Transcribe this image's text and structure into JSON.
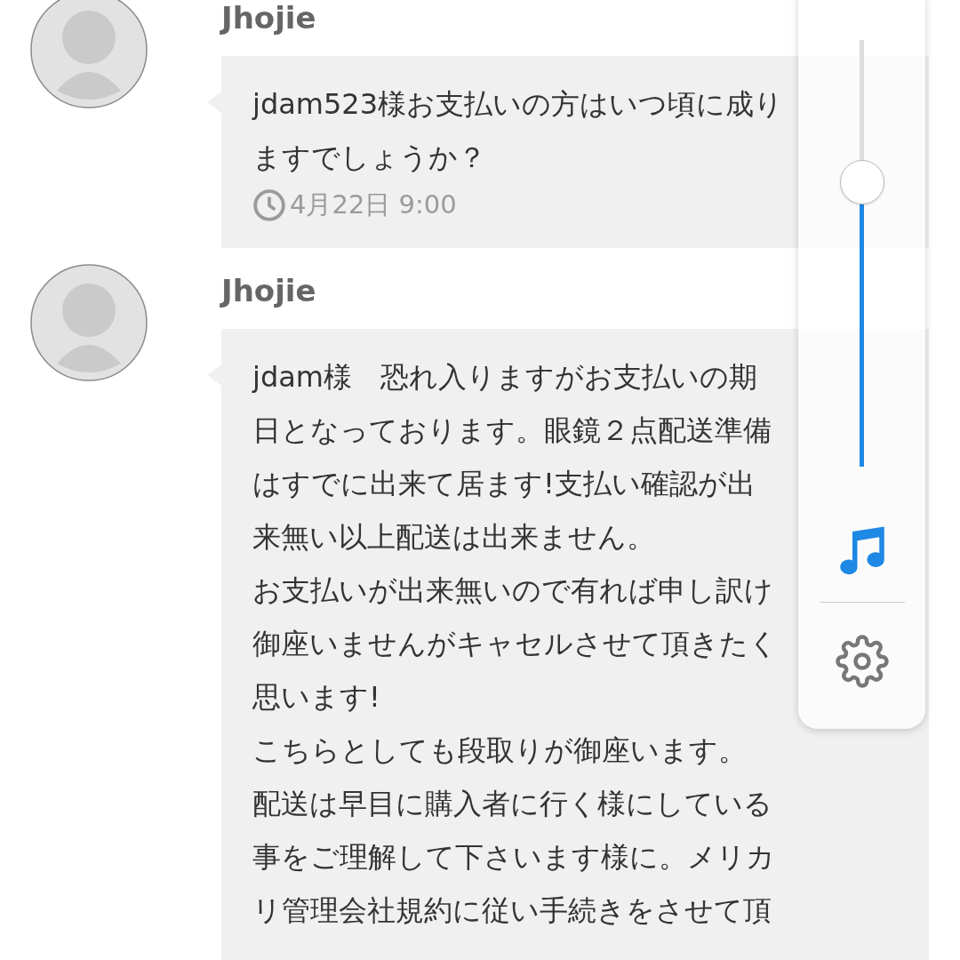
{
  "messages": [
    {
      "sender": "Jhojie",
      "lines": [
        "jdam523様お支払いの方はいつ頃に成り",
        "ますでしょうか？"
      ],
      "time": "4月22日 9:00"
    },
    {
      "sender": "Jhojie",
      "lines": [
        "jdam様　恐れ入りますがお支払いの期",
        "日となっております。眼鏡２点配送準備",
        "はすでに出来て居ます!支払い確認が出",
        "来無い以上配送は出来ません。",
        "お支払いが出来無いので有れば申し訳け",
        "御座いませんがキャセルさせて頂きたく",
        "思います!",
        "こちらとしても段取りが御座います。",
        "配送は早目に購入者に行く様にしている",
        "事をご理解して下さいます様に。メリカ",
        "リ管理会社規約に従い手続きをさせて頂"
      ]
    }
  ],
  "volume_panel": {
    "level": 0.667
  }
}
